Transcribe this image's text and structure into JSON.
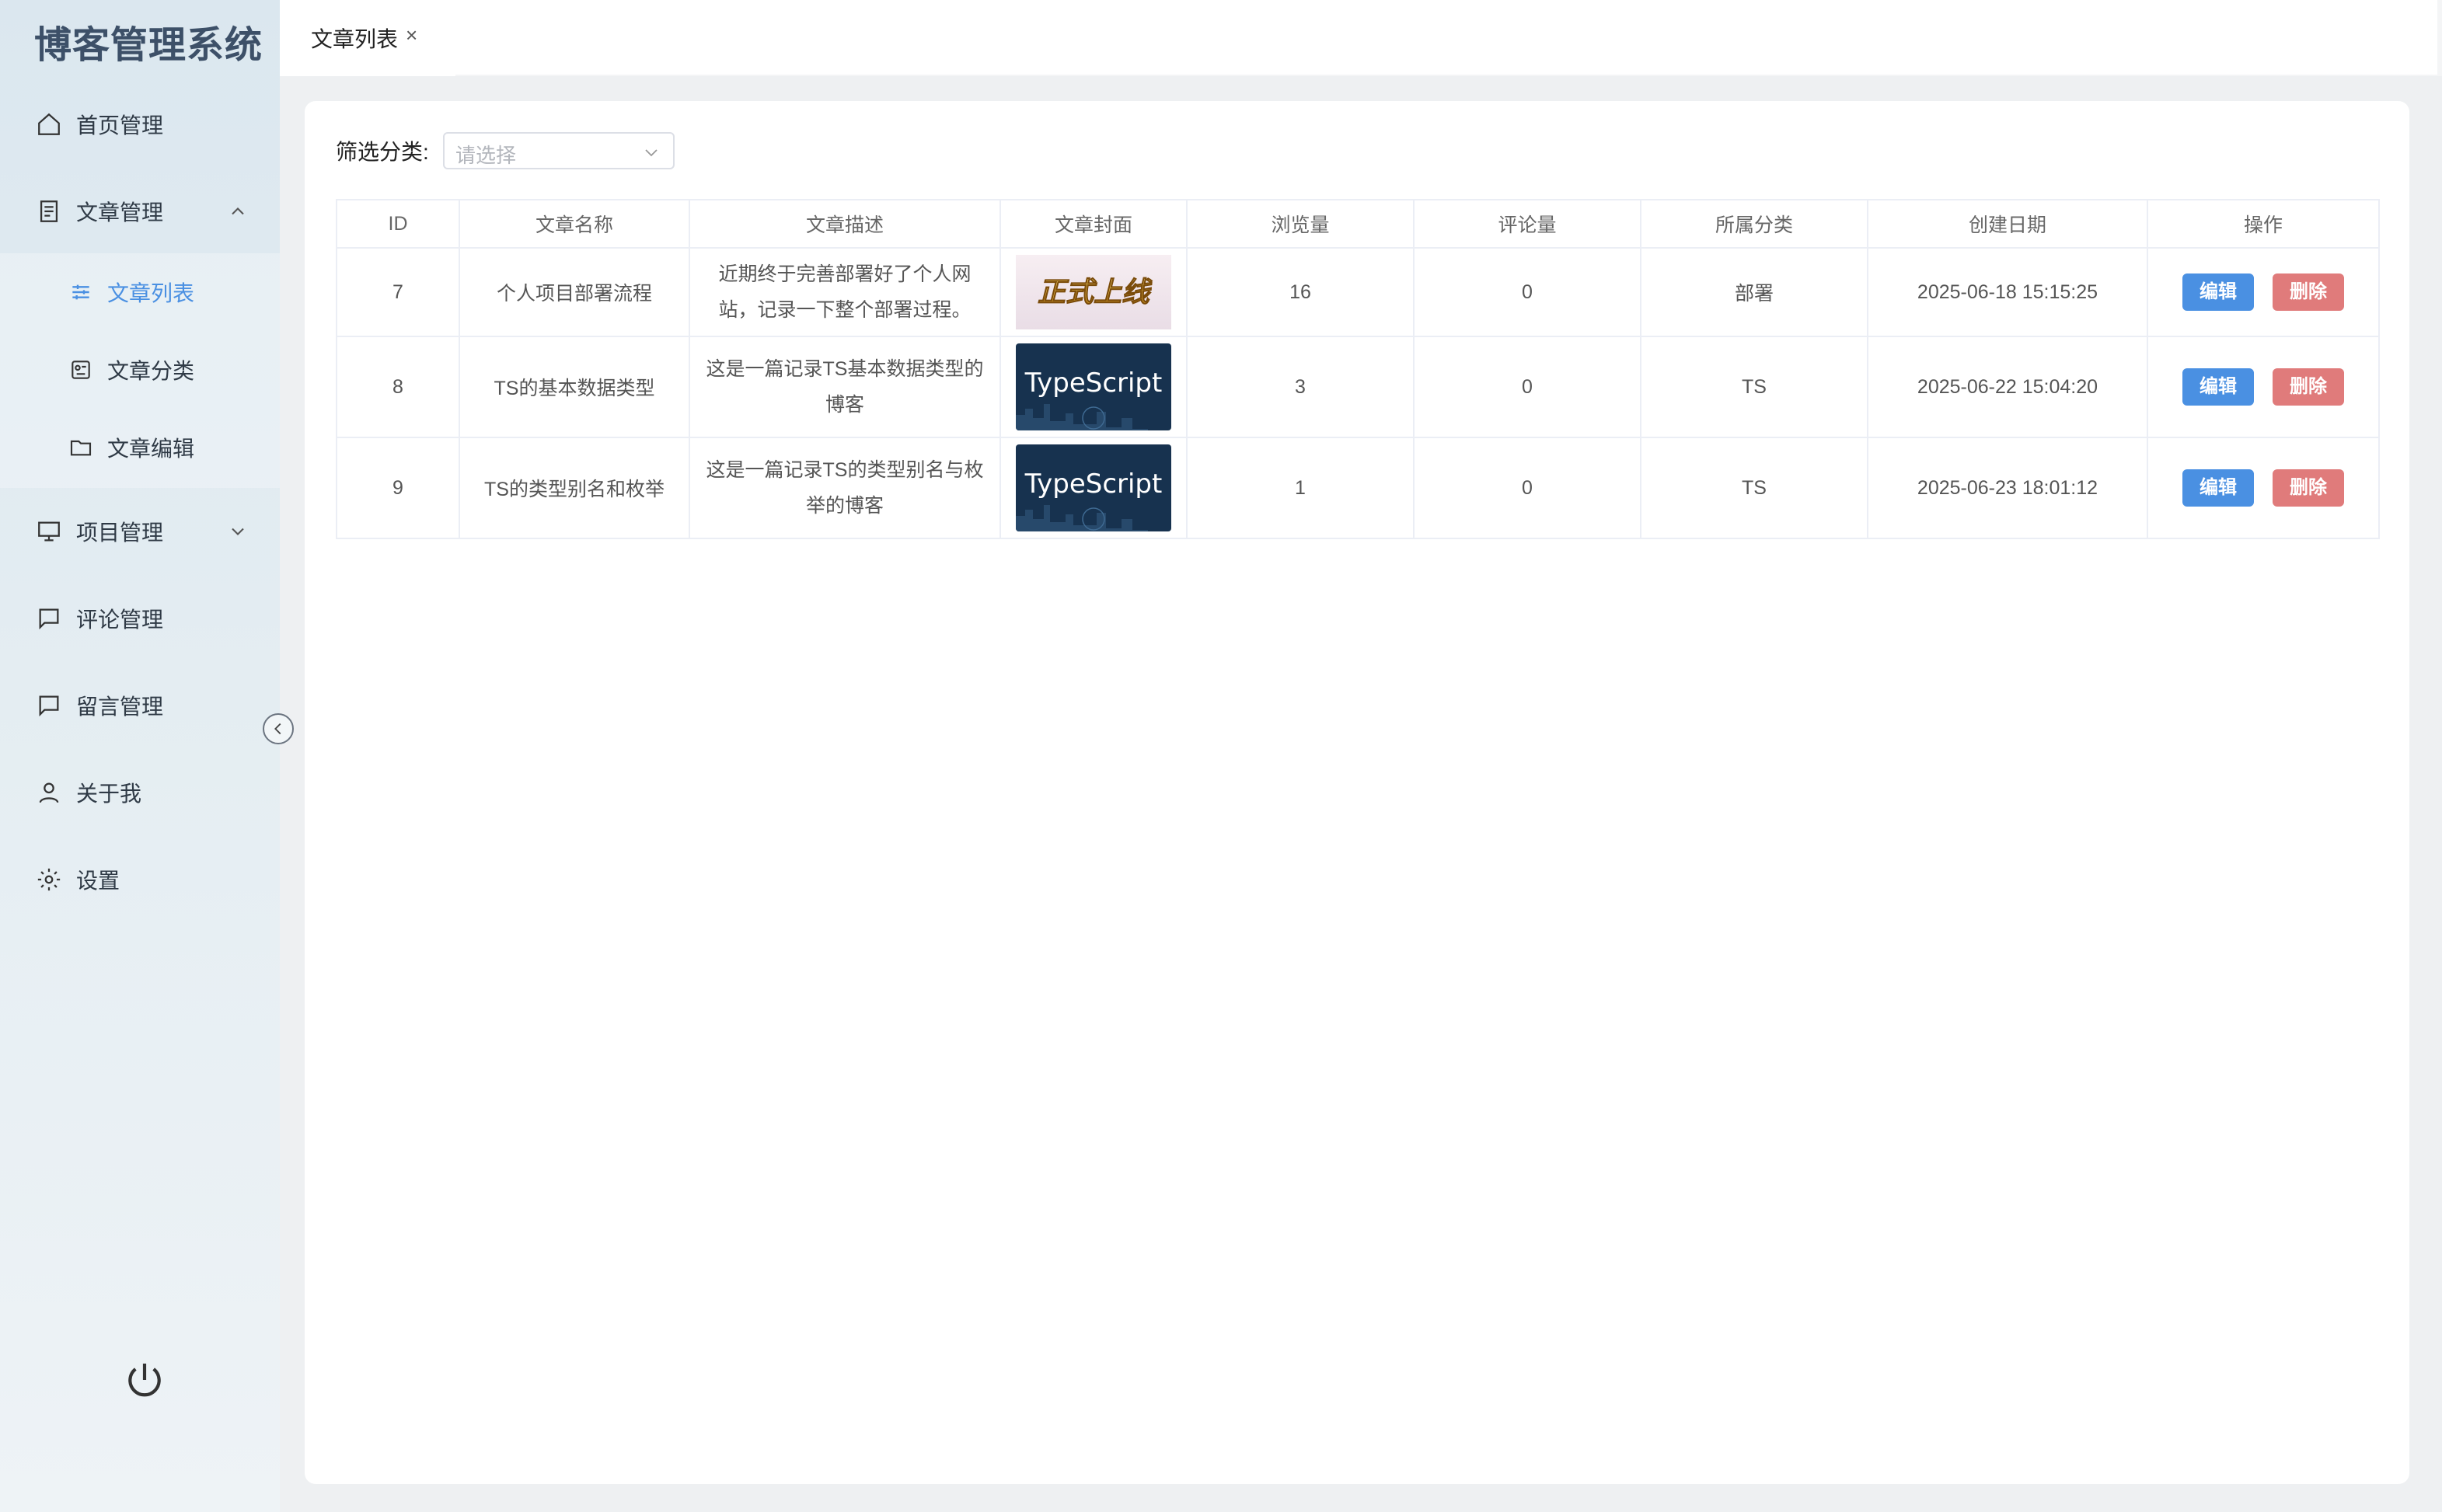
{
  "app": {
    "title": "博客管理系统"
  },
  "sidebar": {
    "items": [
      {
        "label": "首页管理",
        "icon": "home-icon"
      },
      {
        "label": "文章管理",
        "icon": "document-icon",
        "expanded": true,
        "children": [
          {
            "label": "文章列表",
            "icon": "sliders-icon",
            "active": true
          },
          {
            "label": "文章分类",
            "icon": "category-icon"
          },
          {
            "label": "文章编辑",
            "icon": "folder-icon"
          }
        ]
      },
      {
        "label": "项目管理",
        "icon": "monitor-icon",
        "expanded": false
      },
      {
        "label": "评论管理",
        "icon": "comment-icon"
      },
      {
        "label": "留言管理",
        "icon": "message-icon"
      },
      {
        "label": "关于我",
        "icon": "user-icon"
      },
      {
        "label": "设置",
        "icon": "gear-icon"
      }
    ]
  },
  "tabs": [
    {
      "label": "文章列表",
      "close": "×"
    }
  ],
  "filter": {
    "label": "筛选分类:",
    "placeholder": "请选择"
  },
  "table": {
    "columns": [
      "ID",
      "文章名称",
      "文章描述",
      "文章封面",
      "浏览量",
      "评论量",
      "所属分类",
      "创建日期",
      "操作"
    ],
    "rows": [
      {
        "id": "7",
        "name": "个人项目部署流程",
        "desc": "近期终于完善部署好了个人网站，记录一下整个部署过程。",
        "cover": "正式上线",
        "views": "16",
        "comments": "0",
        "category": "部署",
        "date": "2025-06-18 15:15:25"
      },
      {
        "id": "8",
        "name": "TS的基本数据类型",
        "desc": "这是一篇记录TS基本数据类型的博客",
        "cover": "TypeScript",
        "views": "3",
        "comments": "0",
        "category": "TS",
        "date": "2025-06-22 15:04:20"
      },
      {
        "id": "9",
        "name": "TS的类型别名和枚举",
        "desc": "这是一篇记录TS的类型别名与枚举的博客",
        "cover": "TypeScript",
        "views": "1",
        "comments": "0",
        "category": "TS",
        "date": "2025-06-23 18:01:12"
      }
    ],
    "actions": {
      "edit": "编辑",
      "delete": "删除"
    }
  },
  "colors": {
    "accent": "#4a90e2",
    "danger": "#e07b7b",
    "brand_text": "#3d5068"
  }
}
